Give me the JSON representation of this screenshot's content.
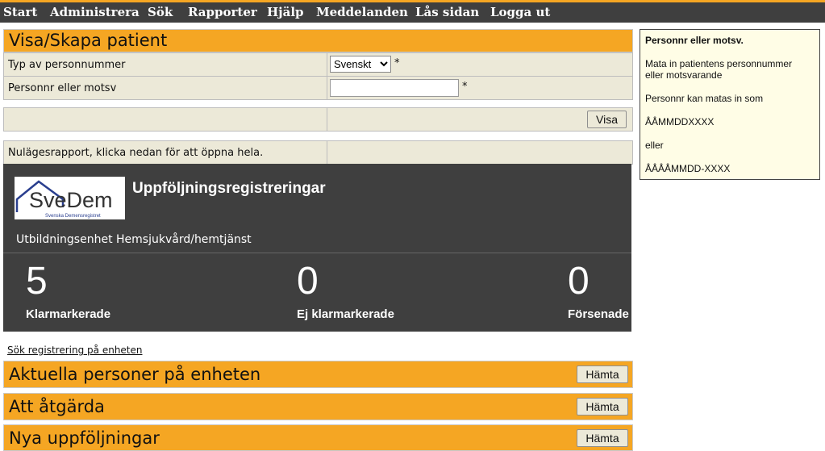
{
  "nav": {
    "items": [
      "Start",
      "Administrera",
      "Sök",
      "Rapporter",
      "Hjälp",
      "Meddelanden",
      "Lås sidan",
      "Logga ut"
    ]
  },
  "patient": {
    "title": "Visa/Skapa patient",
    "type_label": "Typ av personnummer",
    "type_selected": "Svenskt",
    "required_mark": "*",
    "pnr_label": "Personnr eller motsv",
    "pnr_value": "",
    "show_button": "Visa"
  },
  "status_report": {
    "text": "Nulägesrapport, klicka nedan för att öppna hela."
  },
  "dashboard": {
    "logo_text": "SveDem",
    "logo_subtext": "Svenska Demensregistret",
    "title": "Uppföljningsregistreringar",
    "unit": "Utbildningsenhet Hemsjukvård/hemtjänst",
    "stats": [
      {
        "value": "5",
        "label": "Klarmarkerade"
      },
      {
        "value": "0",
        "label": "Ej klarmarkerade"
      },
      {
        "value": "0",
        "label": "Försenade"
      }
    ]
  },
  "search_link": "Sök registrering på enheten",
  "sections": [
    {
      "title": "Aktuella personer på enheten",
      "button": "Hämta"
    },
    {
      "title": "Att åtgärda",
      "button": "Hämta"
    },
    {
      "title": "Nya uppföljningar",
      "button": "Hämta"
    }
  ],
  "help": {
    "heading": "Personnr eller motsv.",
    "line1": "Mata in patientens personnummer",
    "line2": "eller motsvarande",
    "line3": "Personnr kan matas in som",
    "line4": "ÅÅMMDDXXXX",
    "line5": "eller",
    "line6": "ÅÅÅÅMMDD-XXXX"
  },
  "colors": {
    "accent": "#f5a623",
    "nav_bg": "#3f3f3f",
    "row_bg": "#ece9d8",
    "help_bg": "#fffde6"
  }
}
